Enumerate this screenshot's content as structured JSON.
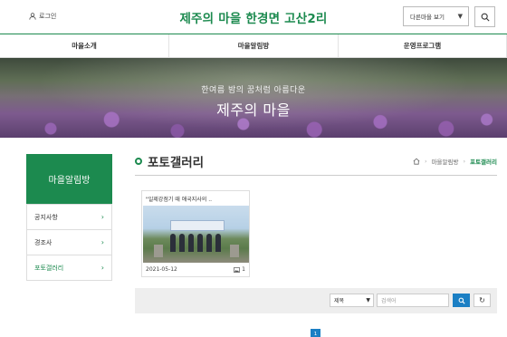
{
  "header": {
    "login_label": "로그인",
    "site_title": "제주의 마을 한경면 고산2리",
    "other_village_label": "다른마을 보기"
  },
  "nav": {
    "items": [
      "마을소개",
      "마을알림방",
      "운영프로그램"
    ]
  },
  "banner": {
    "subtitle": "한여름 밤의 꿈처럼 아름다운",
    "title": "제주의 마을"
  },
  "sidebar": {
    "heading": "마을알림방",
    "items": [
      {
        "label": "공지사항",
        "active": false
      },
      {
        "label": "경조사",
        "active": false
      },
      {
        "label": "포토갤러리",
        "active": true
      }
    ]
  },
  "content": {
    "page_title": "포토갤러리",
    "breadcrumb": {
      "parent": "마을알림방",
      "current": "포토갤러리"
    }
  },
  "gallery": [
    {
      "title": "\"일제강점기 때 애국지사의 ..",
      "date": "2021-05-12",
      "photo_count": "1"
    }
  ],
  "search": {
    "field_selected": "제목",
    "placeholder": "검색어"
  },
  "pagination": {
    "current_page": "1"
  },
  "colors": {
    "brand_green": "#1c8a4f",
    "button_blue": "#1b7fc4"
  }
}
